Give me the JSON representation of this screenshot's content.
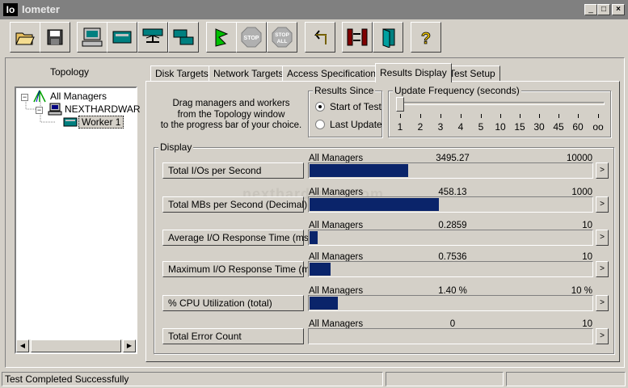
{
  "window": {
    "icon_text": "Io",
    "title": "Iometer",
    "minimize": "_",
    "maximize": "□",
    "close": "×"
  },
  "toolbar": {
    "buttons": [
      {
        "icon": "open-folder-icon"
      },
      {
        "icon": "save-disk-icon"
      },
      {
        "icon": "computer-icon"
      },
      {
        "icon": "disk-worker-icon"
      },
      {
        "icon": "network-worker-icon"
      },
      {
        "icon": "duplicate-worker-icon"
      },
      {
        "icon": "start-flag-icon"
      },
      {
        "icon": "stop-icon",
        "label": "STOP"
      },
      {
        "icon": "stop-all-icon",
        "label": "STOP ALL"
      },
      {
        "icon": "reset-icon"
      },
      {
        "icon": "exit-compare-icon"
      },
      {
        "icon": "door-exit-icon"
      },
      {
        "icon": "help-icon",
        "label": "?"
      }
    ]
  },
  "topology": {
    "label": "Topology",
    "root": "All Managers",
    "manager": "NEXTHARDWAR",
    "worker": "Worker 1",
    "expand_root": "−",
    "expand_manager": "−"
  },
  "tabs": [
    "Disk Targets",
    "Network Targets",
    "Access Specifications",
    "Results Display",
    "Test Setup"
  ],
  "active_tab": "Results Display",
  "info_text": [
    "Drag managers and workers",
    "from the Topology window",
    "to the progress bar of your choice."
  ],
  "results_since": {
    "label": "Results Since",
    "options": [
      "Start of Test",
      "Last Update"
    ],
    "selected": "Start of Test"
  },
  "update_frequency": {
    "label": "Update Frequency (seconds)",
    "ticks": [
      "1",
      "2",
      "3",
      "4",
      "5",
      "10",
      "15",
      "30",
      "45",
      "60",
      "oo"
    ],
    "value": "1"
  },
  "display": {
    "label": "Display",
    "metrics": [
      {
        "button": "Total I/Os per Second",
        "source": "All Managers",
        "value": "3495.27",
        "max": "10000",
        "fill": 0.3495
      },
      {
        "button": "Total MBs per Second (Decimal)",
        "source": "All Managers",
        "value": "458.13",
        "max": "1000",
        "fill": 0.458
      },
      {
        "button": "Average I/O Response Time (ms)",
        "source": "All Managers",
        "value": "0.2859",
        "max": "10",
        "fill": 0.0286
      },
      {
        "button": "Maximum I/O Response Time (ms)",
        "source": "All Managers",
        "value": "0.7536",
        "max": "10",
        "fill": 0.075
      },
      {
        "button": "% CPU Utilization (total)",
        "source": "All Managers",
        "value": "1.40 %",
        "max": "10 %",
        "fill": 0.1
      },
      {
        "button": "Total Error Count",
        "source": "All Managers",
        "value": "0",
        "max": "10",
        "fill": 0
      }
    ],
    "arrow": ">"
  },
  "watermark": "nexthardware.com",
  "status": {
    "text": "Test Completed Successfully"
  },
  "colors": {
    "bar_fill": "#0a246a",
    "titlebar": "#808080",
    "face": "#d4d0c8"
  }
}
